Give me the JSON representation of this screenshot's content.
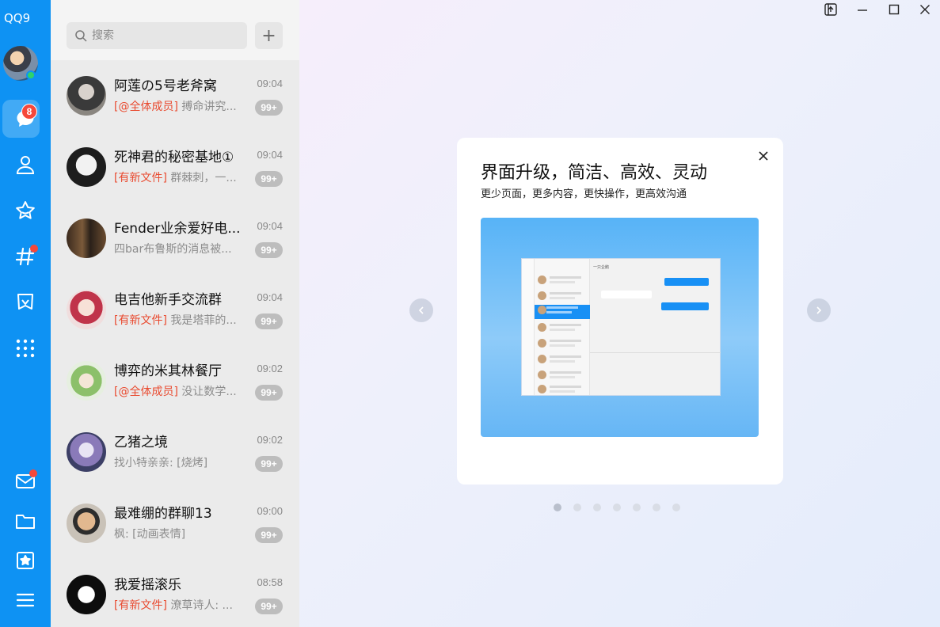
{
  "app": {
    "logo": "QQ9"
  },
  "nav": {
    "messages_badge": "8",
    "items": [
      "messages",
      "contacts",
      "favorites",
      "channels",
      "games",
      "apps",
      "mail",
      "files",
      "collections",
      "menu"
    ]
  },
  "search": {
    "placeholder": "搜索",
    "add": "+"
  },
  "conversations": [
    {
      "name": "阿莲の5号老斧窝",
      "time": "09:04",
      "tag": "[@全体成员]",
      "text": " 搏命讲究...",
      "count": "99+"
    },
    {
      "name": "死神君的秘密基地①",
      "time": "09:04",
      "tag": "[有新文件]",
      "text": " 群棘刺，一...",
      "count": "99+"
    },
    {
      "name": "Fender业余爱好电...",
      "time": "09:04",
      "tag": "",
      "text": "四bar布鲁斯的消息被...",
      "count": "99+"
    },
    {
      "name": "电吉他新手交流群",
      "time": "09:04",
      "tag": "[有新文件]",
      "text": " 我是塔菲的...",
      "count": "99+"
    },
    {
      "name": "博弈的米其林餐厅",
      "time": "09:02",
      "tag": "[@全体成员]",
      "text": " 没让数学...",
      "count": "99+"
    },
    {
      "name": "乙猪之境",
      "time": "09:02",
      "tag": "",
      "text": "找小特亲亲: [烧烤]",
      "count": "99+"
    },
    {
      "name": "最难绷的群聊13",
      "time": "09:00",
      "tag": "",
      "text": "枫: [动画表情]",
      "count": "99+"
    },
    {
      "name": "我爱摇滚乐",
      "time": "08:58",
      "tag": "[有新文件]",
      "text": " 潦草诗人: ...",
      "count": "99+"
    }
  ],
  "intro_card": {
    "title": "界面升级，简洁、高效、灵动",
    "subtitle": "更少页面，更多内容，更快操作，更高效沟通",
    "preview_chat_title": "一只企鹅"
  },
  "carousel": {
    "pages": 7,
    "current": 1
  },
  "colors": {
    "nav": "#0e92f3",
    "badge": "#f5483b",
    "tag": "#e94a2f",
    "count": "#bdbdbd"
  }
}
